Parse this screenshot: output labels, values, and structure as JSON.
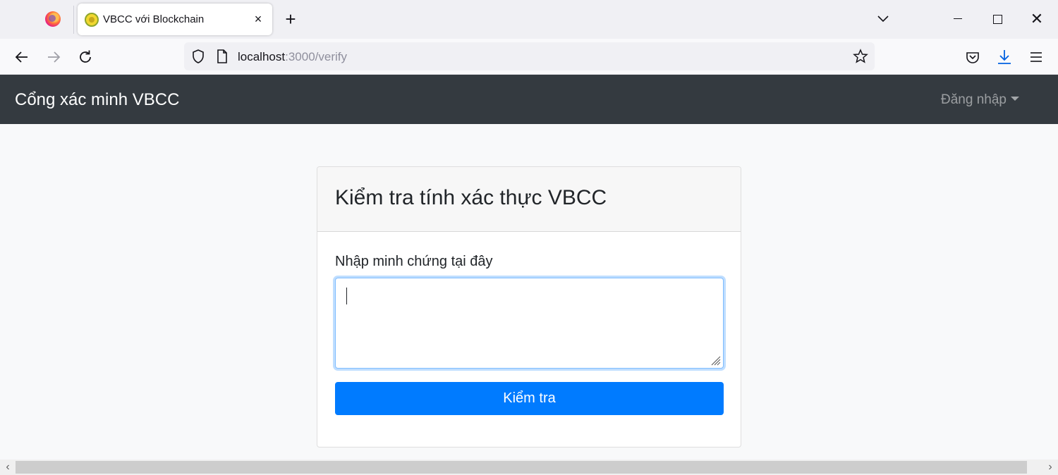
{
  "browser": {
    "tab_title": "VBCC với Blockchain",
    "tab_close_glyph": "×",
    "new_tab_glyph": "+",
    "url_host": "localhost",
    "url_rest": ":3000/verify",
    "window_close_glyph": "✕"
  },
  "app": {
    "brand": "Cổng xác minh VBCC",
    "login_menu": "Đăng nhập"
  },
  "card": {
    "title": "Kiểm tra tính xác thực VBCC",
    "proof_label": "Nhập minh chứng tại đây",
    "proof_value": "",
    "submit_label": "Kiểm tra"
  },
  "colors": {
    "navbar": "#343a40",
    "primary": "#007bff",
    "page_bg": "#f8f9fa"
  },
  "icons": [
    "firefox-icon",
    "back-icon",
    "forward-icon",
    "reload-icon",
    "shield-icon",
    "page-icon",
    "bookmark-star-icon",
    "pocket-icon",
    "download-icon",
    "menu-icon"
  ]
}
